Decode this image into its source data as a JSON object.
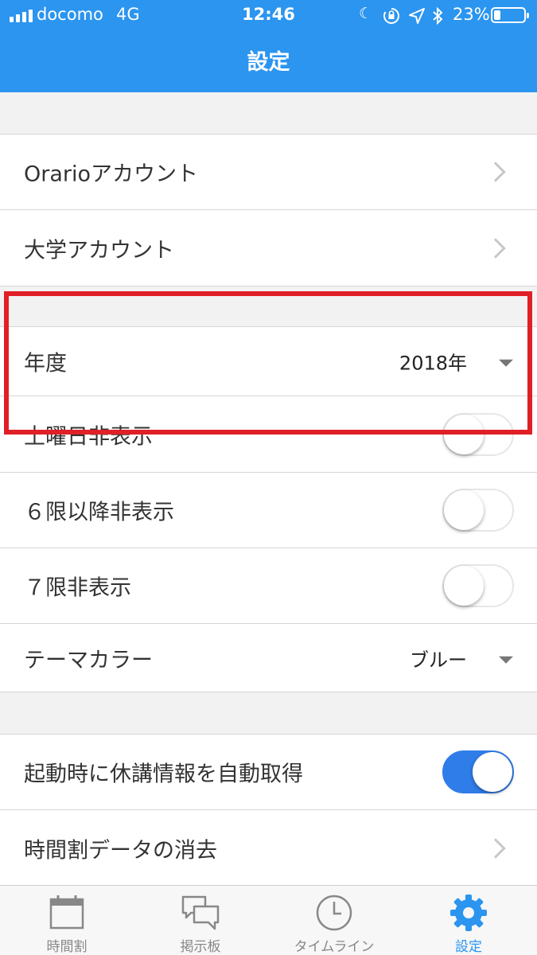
{
  "status_bar": {
    "carrier": "docomo",
    "network": "4G",
    "time": "12:46",
    "battery": "23%",
    "battery_level": 0.23,
    "icons": [
      "signal-icon",
      "moon-icon",
      "rotation-lock-icon",
      "location-icon",
      "bluetooth-icon",
      "battery-icon"
    ]
  },
  "header": {
    "title": "設定"
  },
  "settings": {
    "orario_account": "Orarioアカウント",
    "university_account": "大学アカウント",
    "year_label": "年度",
    "year_value": "2018年",
    "hide_saturday": "土曜日非表示",
    "hide_saturday_on": false,
    "hide_period6": "６限以降非表示",
    "hide_period6_on": false,
    "hide_period7": "７限非表示",
    "hide_period7_on": false,
    "theme_label": "テーマカラー",
    "theme_value": "ブルー",
    "auto_fetch": "起動時に休講情報を自動取得",
    "auto_fetch_on": true,
    "clear_data": "時間割データの消去"
  },
  "tabs": [
    {
      "label": "時間割",
      "icon": "calendar-icon",
      "active": false
    },
    {
      "label": "掲示板",
      "icon": "chat-bubbles-icon",
      "active": false
    },
    {
      "label": "タイムライン",
      "icon": "clock-icon",
      "active": false
    },
    {
      "label": "設定",
      "icon": "gear-icon",
      "active": true
    }
  ],
  "colors": {
    "accent": "#2b95f0",
    "toggle_on": "#2f7de8",
    "highlight": "#e01f26"
  }
}
